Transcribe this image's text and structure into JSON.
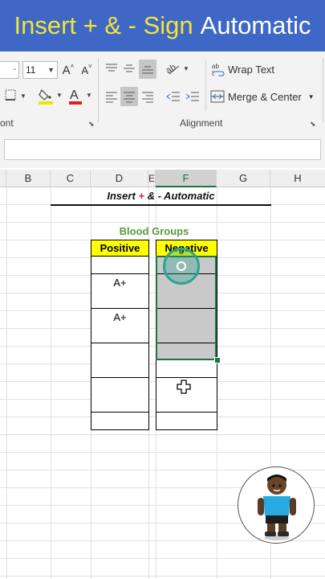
{
  "banner": {
    "part1": "Insert + & - Sign",
    "part2": "Automatic"
  },
  "ribbon": {
    "font_name": "-",
    "font_size": "11",
    "increase_font_label": "A",
    "decrease_font_label": "A",
    "wrap_text_label": "Wrap Text",
    "merge_center_label": "Merge & Center",
    "group_font_label": "ont",
    "group_alignment_label": "Alignment"
  },
  "formula_bar": {
    "value": ""
  },
  "columns": [
    "B",
    "C",
    "D",
    "E",
    "F",
    "G",
    "H"
  ],
  "selected_column": "F",
  "sheet": {
    "title_part1": "Insert ",
    "title_plus": "+",
    "title_part2": " & - Automatic",
    "table_title": "Blood Groups",
    "headers": [
      "Positive",
      "Negative"
    ],
    "positive": [
      "",
      "A+",
      "",
      "A+",
      "",
      "",
      "",
      "",
      "",
      ""
    ],
    "negative": [
      "",
      "",
      "",
      "",
      "",
      "",
      "",
      "",
      "",
      ""
    ]
  },
  "colors": {
    "banner_bg": "#3f68c6",
    "banner_yellow": "#f3e43a",
    "excel_green": "#217346",
    "header_yellow": "#ffff00",
    "table_title_green": "#5a9a3c",
    "selection_grey": "#c9c9c9",
    "minus_red": "#e02020"
  }
}
